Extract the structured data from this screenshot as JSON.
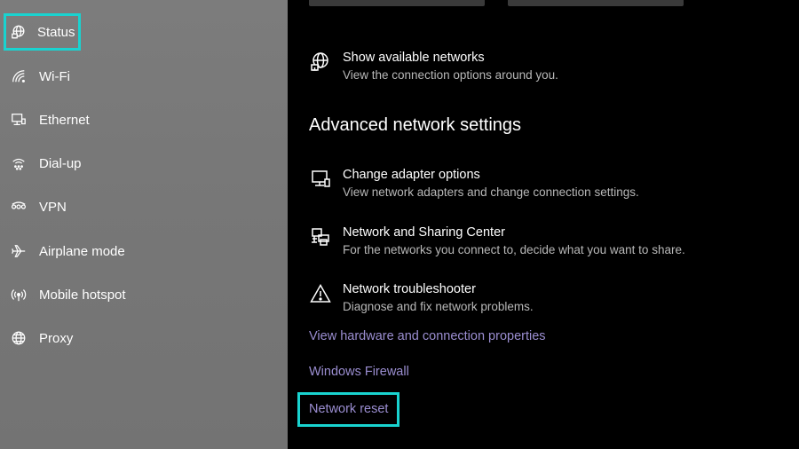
{
  "sidebar": {
    "items": [
      {
        "label": "Status",
        "icon": "status-globe-icon",
        "selected": true
      },
      {
        "label": "Wi-Fi",
        "icon": "wifi-icon"
      },
      {
        "label": "Ethernet",
        "icon": "ethernet-icon"
      },
      {
        "label": "Dial-up",
        "icon": "dialup-icon"
      },
      {
        "label": "VPN",
        "icon": "vpn-icon"
      },
      {
        "label": "Airplane mode",
        "icon": "airplane-icon"
      },
      {
        "label": "Mobile hotspot",
        "icon": "hotspot-icon"
      },
      {
        "label": "Proxy",
        "icon": "globe-icon"
      }
    ]
  },
  "main": {
    "show_networks": {
      "title": "Show available networks",
      "desc": "View the connection options around you.",
      "icon": "network-globe-icon"
    },
    "advanced_heading": "Advanced network settings",
    "settings": [
      {
        "title": "Change adapter options",
        "desc": "View network adapters and change connection settings.",
        "icon": "monitor-icon"
      },
      {
        "title": "Network and Sharing Center",
        "desc": "For the networks you connect to, decide what you want to share.",
        "icon": "sharing-printer-icon"
      },
      {
        "title": "Network troubleshooter",
        "desc": "Diagnose and fix network problems.",
        "icon": "warning-icon"
      }
    ],
    "links": [
      {
        "label": "View hardware and connection properties"
      },
      {
        "label": "Windows Firewall"
      },
      {
        "label": "Network reset",
        "highlighted": true
      }
    ]
  },
  "colors": {
    "sidebar_bg": "#787878",
    "main_bg": "#000000",
    "highlight": "#19d3d0",
    "link": "#9b8ed1"
  }
}
